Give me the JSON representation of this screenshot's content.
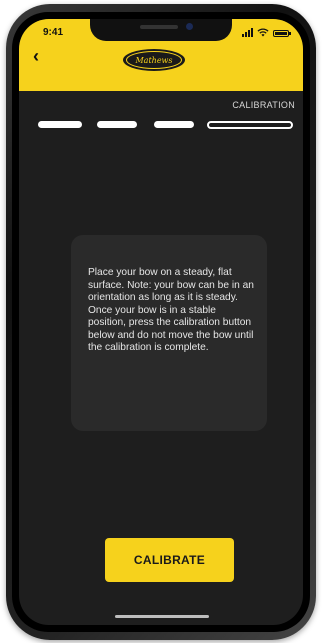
{
  "status_bar": {
    "time": "9:41",
    "icons": [
      "signal-icon",
      "wifi-icon",
      "battery-icon"
    ]
  },
  "header": {
    "back_icon": "chevron-left-icon",
    "back_glyph": "‹",
    "logo_text": "Mathews",
    "background_color": "#f6d21c"
  },
  "progress": {
    "current_step_label": "CALIBRATION",
    "total_steps": 4,
    "current_step": 4
  },
  "instructions": {
    "text": "Place your bow on a steady, flat surface. Note: your bow can be in an orientation as long as it is steady. Once your bow is in a stable position, press the calibration button below and do not move the bow until the calibration is complete."
  },
  "actions": {
    "calibrate_label": "CALIBRATE"
  },
  "colors": {
    "accent": "#f6d21c",
    "screen_background": "#1e1e1e",
    "card_background": "#2a2a2a"
  }
}
